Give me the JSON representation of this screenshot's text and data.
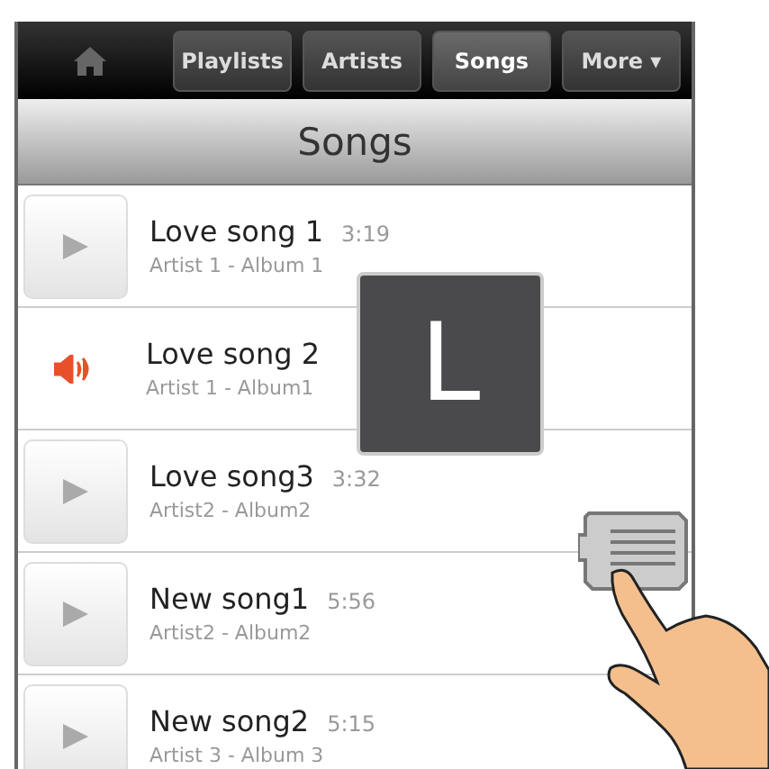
{
  "nav": {
    "tabs": [
      {
        "label": "Playlists",
        "selected": false
      },
      {
        "label": "Artists",
        "selected": false
      },
      {
        "label": "Songs",
        "selected": true
      },
      {
        "label": "More ▾",
        "selected": false
      }
    ]
  },
  "header": {
    "title": "Songs"
  },
  "songs": [
    {
      "title": "Love song 1",
      "duration": "3:19",
      "subtitle": "Artist 1 - Album 1",
      "playing": false
    },
    {
      "title": "Love song 2",
      "subtitle": "Artist 1 - Album1",
      "playing": true
    },
    {
      "title": "Love song3",
      "duration": "3:32",
      "subtitle": "Artist2 - Album2",
      "playing": false
    },
    {
      "title": "New song1",
      "duration": "5:56",
      "subtitle": "Artist2 - Album2",
      "playing": false
    },
    {
      "title": "New song2",
      "duration": "5:15",
      "subtitle": "Artist 3 - Album 3",
      "playing": false
    }
  ],
  "letter_overlay": {
    "letter": "L"
  }
}
